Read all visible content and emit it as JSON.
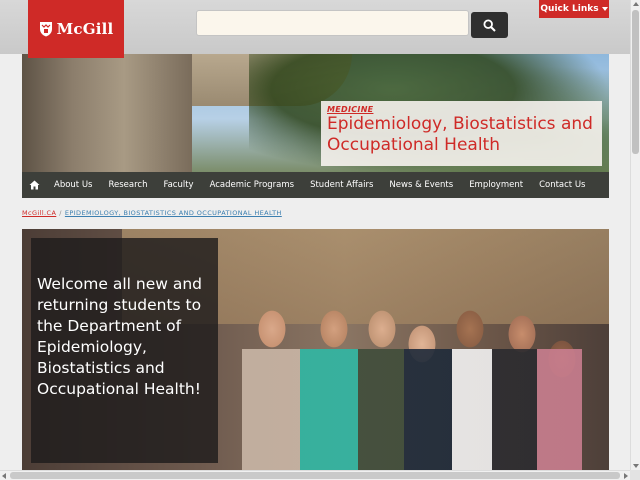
{
  "header": {
    "logo_text": "McGill",
    "search_placeholder": "",
    "quick_links_label": "Quick Links"
  },
  "banner": {
    "faculty": "MEDICINE",
    "department_title": "Epidemiology, Biostatistics and Occupational Health"
  },
  "nav": {
    "items": [
      "About Us",
      "Research",
      "Faculty",
      "Academic Programs",
      "Student Affairs",
      "News & Events",
      "Employment",
      "Contact Us"
    ]
  },
  "breadcrumb": {
    "home": "McGill.CA",
    "separator": "/",
    "current": "EPIDEMIOLOGY, BIOSTATISTICS AND OCCUPATIONAL HEALTH"
  },
  "hero": {
    "welcome_text": "Welcome all new and returning students to the Department of Epidemiology, Biostatistics and Occupational Health!"
  },
  "colors": {
    "brand_red": "#cf2a27",
    "nav_bg": "#3d3f3a",
    "link_blue": "#3c7fb0"
  },
  "icons": {
    "search": "search-icon",
    "home": "home-icon",
    "logo": "mcgill-shield-icon"
  }
}
